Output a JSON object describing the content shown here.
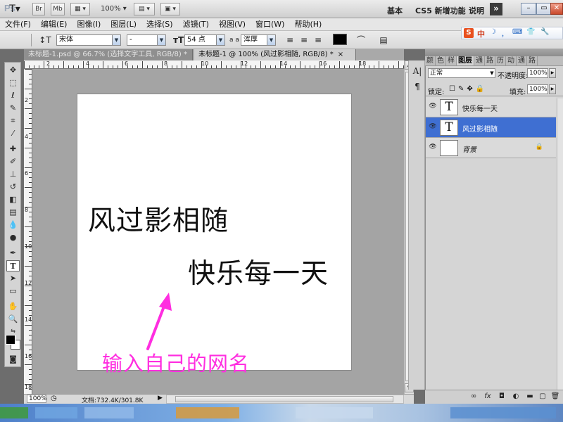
{
  "app": {
    "logo": "Ps",
    "title_buttons": [
      "Br",
      "Mb"
    ],
    "zoom": "100%",
    "workspaces": [
      "基本",
      "CS5 新增功能",
      "说明"
    ],
    "more": "»",
    "window_controls": [
      "–",
      "▭",
      "✕"
    ]
  },
  "menu": [
    "文件(F)",
    "编辑(E)",
    "图像(I)",
    "图层(L)",
    "选择(S)",
    "滤镜(T)",
    "视图(V)",
    "窗口(W)",
    "帮助(H)"
  ],
  "options": {
    "tool_icon": "T",
    "orient_icon": "↕T",
    "font_family": "宋体",
    "font_style": "-",
    "font_size": "54 点",
    "aa_label": "a a",
    "aa_mode": "浑厚",
    "color_hex": "#000000"
  },
  "ime": {
    "brand": "S",
    "mode": "中",
    "icons": [
      "☽",
      "，",
      "⌨",
      "👕",
      "🔧"
    ]
  },
  "tabs": [
    {
      "label": "未标题-1.psd @ 66.7% (选择文字工具, RGB/8) *",
      "close": "×"
    },
    {
      "label": "未标题-1 @ 100% (风过影相随, RGB/8) *",
      "close": "×"
    }
  ],
  "ruler": {
    "top": [
      "2",
      "4",
      "6",
      "8",
      "10",
      "12",
      "14",
      "16",
      "18"
    ],
    "left": [
      "2",
      "4",
      "6",
      "8",
      "10",
      "12",
      "14",
      "16",
      "18"
    ]
  },
  "canvas": {
    "text1": "风过影相随",
    "text2": "快乐每一天",
    "hint": "输入自己的网名",
    "arrow_color": "#ff2ee0"
  },
  "status": {
    "zoom": "100%",
    "doc_info": "文档:732.4K/301.8K"
  },
  "layers_panel": {
    "tabs": [
      "颜",
      "色",
      "样",
      "图层",
      "通",
      "路",
      "历",
      "动",
      "通",
      "路"
    ],
    "blend_mode": "正常",
    "opacity_label": "不透明度:",
    "opacity": "100%",
    "lock_label": "锁定:",
    "fill_label": "填充:",
    "fill": "100%",
    "layers": [
      {
        "name": "快乐每一天",
        "type": "text",
        "selected": false
      },
      {
        "name": "风过影相随",
        "type": "text",
        "selected": true
      },
      {
        "name": "背景",
        "type": "background",
        "selected": false
      }
    ],
    "footer_icons": [
      "∞",
      "fx",
      "◘",
      "◐",
      "▬",
      "▢",
      "🗑"
    ]
  }
}
